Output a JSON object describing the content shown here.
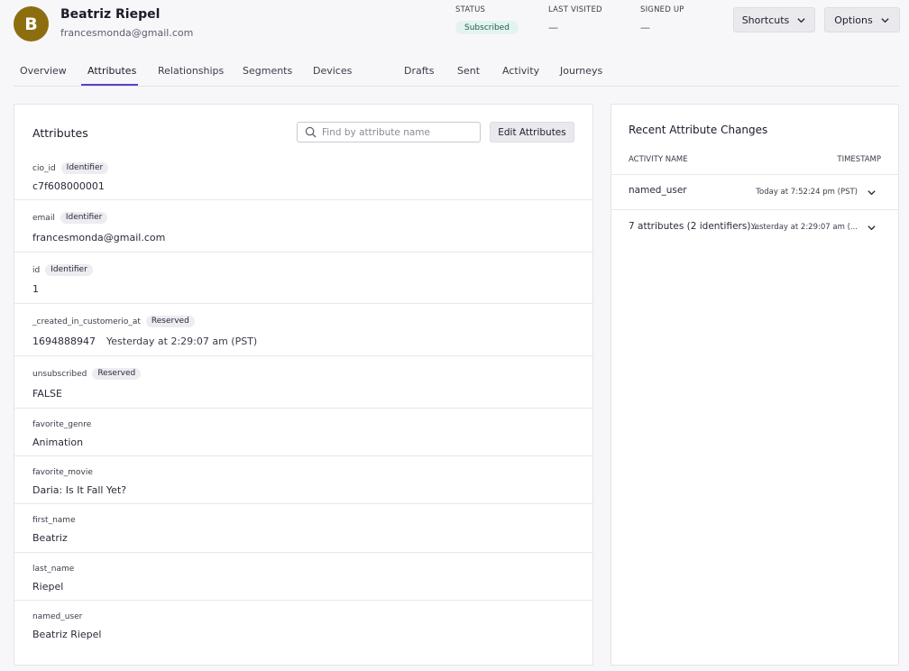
{
  "profile": {
    "avatar_letter": "B",
    "name": "Beatriz Riepel",
    "email": "francesmonda@gmail.com"
  },
  "meta": {
    "status_label": "STATUS",
    "status_value": "Subscribed",
    "last_visited_label": "LAST VISITED",
    "last_visited_value": "—",
    "signed_up_label": "SIGNED UP",
    "signed_up_value": "—"
  },
  "header_buttons": {
    "shortcuts": "Shortcuts",
    "options": "Options"
  },
  "tabs": [
    {
      "label": "Overview"
    },
    {
      "label": "Attributes",
      "active": true
    },
    {
      "label": "Relationships"
    },
    {
      "label": "Segments"
    },
    {
      "label": "Devices"
    },
    {
      "label": "Drafts"
    },
    {
      "label": "Sent"
    },
    {
      "label": "Activity"
    },
    {
      "label": "Journeys"
    }
  ],
  "attributes_panel": {
    "title": "Attributes",
    "search_placeholder": "Find by attribute name",
    "edit_button": "Edit Attributes",
    "rows": [
      {
        "key": "cio_id",
        "badge": "Identifier",
        "value": "c7f608000001"
      },
      {
        "key": "email",
        "badge": "Identifier",
        "value": "francesmonda@gmail.com"
      },
      {
        "key": "id",
        "badge": "Identifier",
        "value": "1"
      },
      {
        "key": "_created_in_customerio_at",
        "badge": "Reserved",
        "value": "1694888947",
        "value_extra": "Yesterday at 2:29:07 am (PST)"
      },
      {
        "key": "unsubscribed",
        "badge": "Reserved",
        "value": "FALSE"
      },
      {
        "key": "favorite_genre",
        "value": "Animation"
      },
      {
        "key": "favorite_movie",
        "value": "Daria: Is It Fall Yet?"
      },
      {
        "key": "first_name",
        "value": "Beatriz"
      },
      {
        "key": "last_name",
        "value": "Riepel"
      },
      {
        "key": "named_user",
        "value": "Beatriz Riepel"
      }
    ]
  },
  "changes_panel": {
    "title": "Recent Attribute Changes",
    "col_activity": "ACTIVITY NAME",
    "col_timestamp": "TIMESTAMP",
    "rows": [
      {
        "name": "named_user",
        "timestamp": "Today at 7:52:24 pm (PST)"
      },
      {
        "name": "7 attributes (2 identifiers)...",
        "timestamp": "Yesterday at 2:29:07 am (..."
      }
    ]
  },
  "colors": {
    "accent": "#5e3fc4",
    "avatar": "#8c6e10",
    "status_bg": "#e3f4ef"
  },
  "icons": {
    "search": "search-icon",
    "chevron": "chevron-down-icon"
  }
}
